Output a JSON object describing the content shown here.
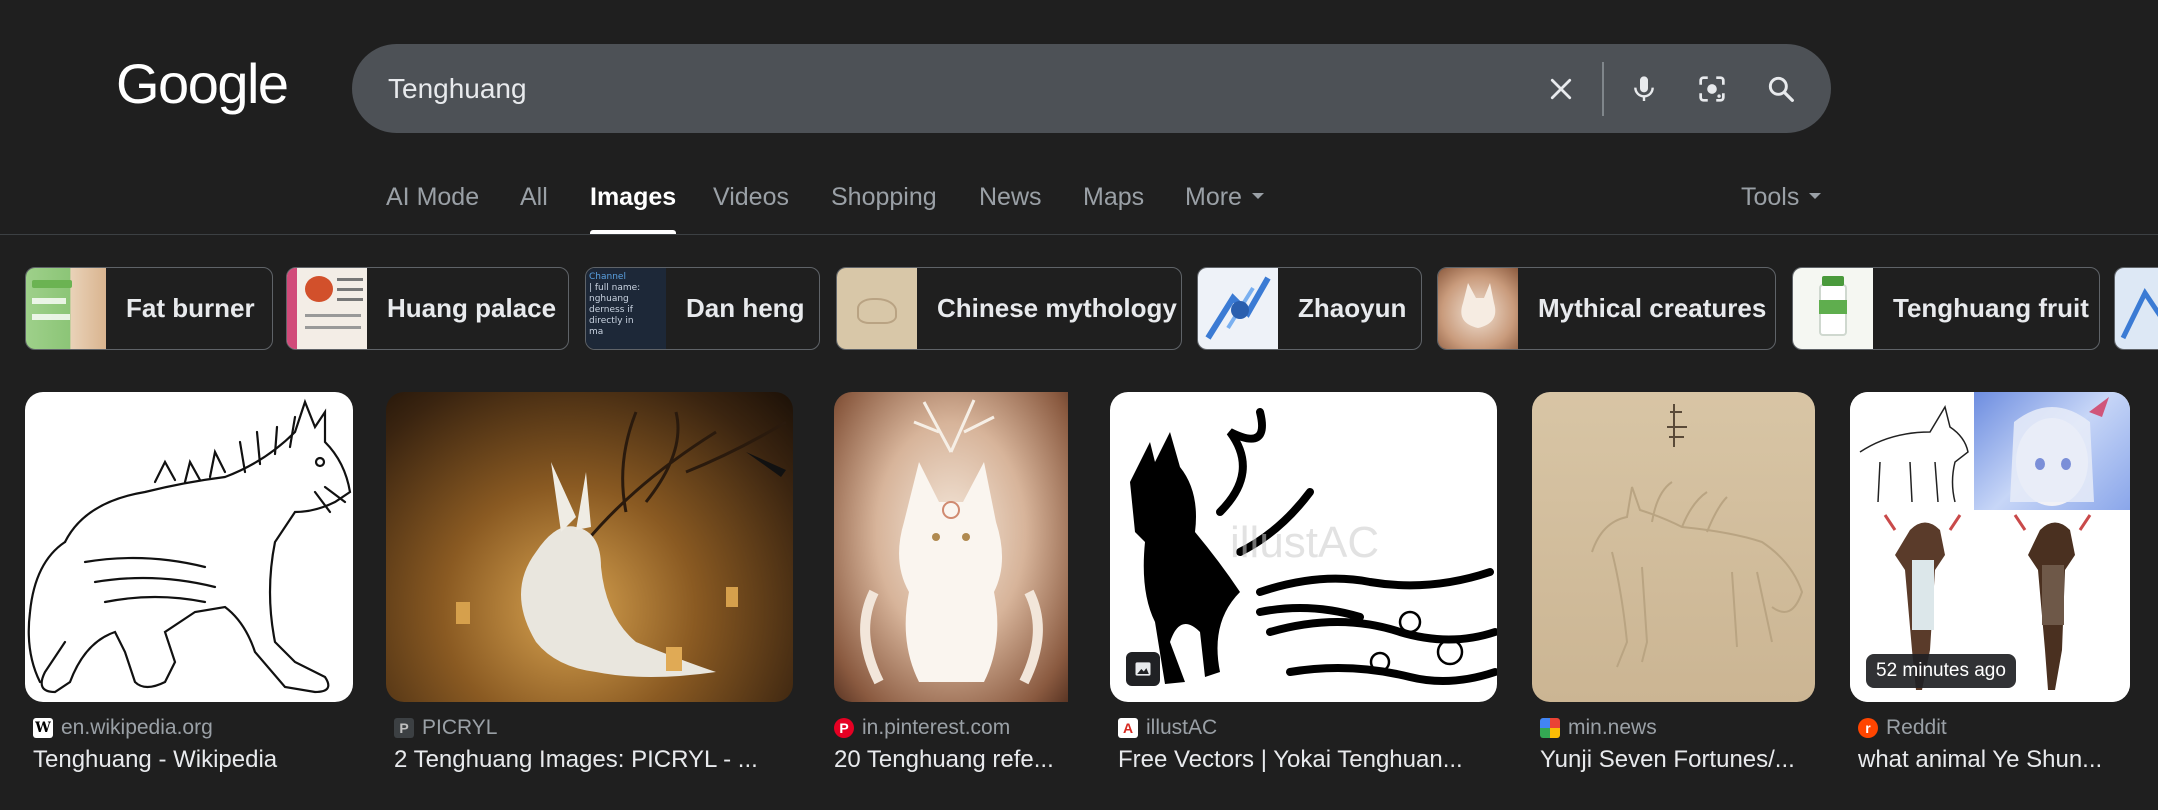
{
  "logo": "Google",
  "search": {
    "query": "Tenghuang"
  },
  "tabs": [
    {
      "label": "AI Mode"
    },
    {
      "label": "All"
    },
    {
      "label": "Images"
    },
    {
      "label": "Videos"
    },
    {
      "label": "Shopping"
    },
    {
      "label": "News"
    },
    {
      "label": "Maps"
    },
    {
      "label": "More"
    }
  ],
  "tools_label": "Tools",
  "chips": [
    {
      "label": "Fat burner"
    },
    {
      "label": "Huang palace"
    },
    {
      "label": "Dan heng"
    },
    {
      "label": "Chinese mythology"
    },
    {
      "label": "Zhaoyun"
    },
    {
      "label": "Mythical creatures"
    },
    {
      "label": "Tenghuang fruit"
    }
  ],
  "results": [
    {
      "source": "en.wikipedia.org",
      "title": "Tenghuang - Wikipedia"
    },
    {
      "source": "PICRYL",
      "title": "2 Tenghuang Images: PICRYL - ..."
    },
    {
      "source": "in.pinterest.com",
      "title": "20 Tenghuang refe..."
    },
    {
      "source": "illustAC",
      "title": "Free Vectors | Yokai Tenghuan..."
    },
    {
      "source": "min.news",
      "title": "Yunji Seven Fortunes/..."
    },
    {
      "source": "Reddit",
      "title": "what animal Ye Shun...",
      "badge": "52 minutes ago"
    }
  ],
  "chip_thumb_texts": [
    "Channel",
    "| full name:",
    "nghuang",
    "derness if directly in",
    "ma"
  ],
  "image_texts": {
    "watermark": "illustAC"
  }
}
